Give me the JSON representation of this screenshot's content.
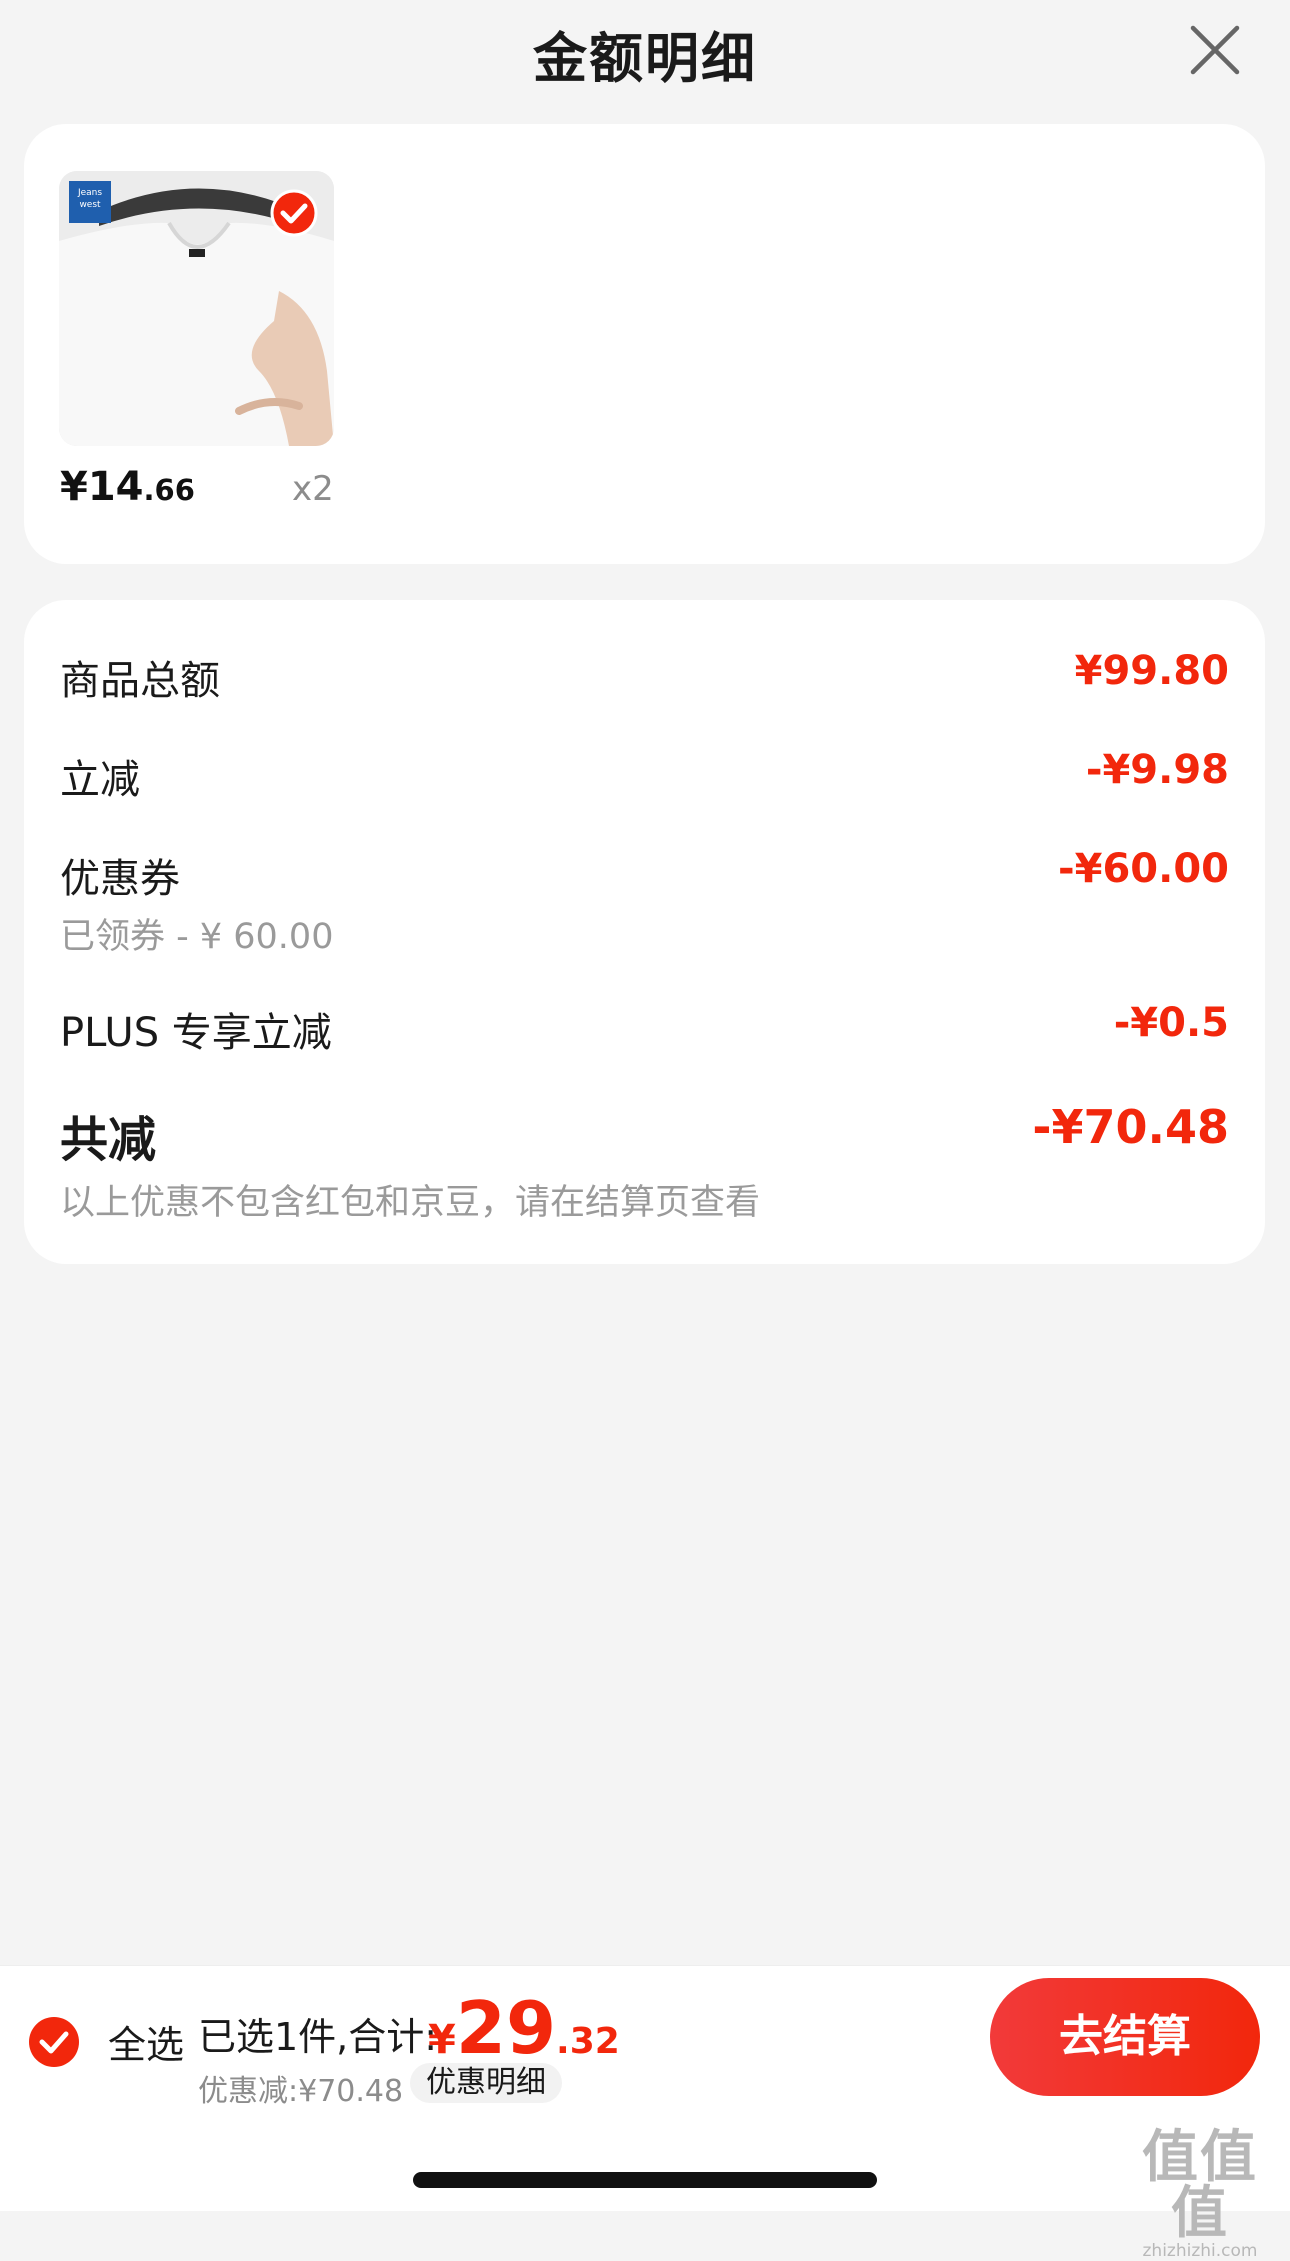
{
  "header": {
    "title": "金额明细"
  },
  "product": {
    "brand_logo_text": "Jeans west",
    "price_int": "¥14",
    "price_dec": ".66",
    "qty": "x2"
  },
  "summary": {
    "goods_total_label": "商品总额",
    "goods_total_value": "¥99.80",
    "instant_discount_label": "立减",
    "instant_discount_value": "-¥9.98",
    "coupon_label": "优惠券",
    "coupon_value": "-¥60.00",
    "coupon_note": "已领券 - ¥ 60.00",
    "plus_label": "PLUS 专享立减",
    "plus_value": "-¥0.5",
    "total_label": "共减",
    "total_value": "-¥70.48",
    "note": "以上优惠不包含红包和京豆，请在结算页查看"
  },
  "bottom": {
    "select_all": "全选",
    "selected_count": "已选1件,合计:",
    "total_currency": "¥",
    "total_int": "29",
    "total_dec": ".32",
    "saved": "优惠减:¥70.48",
    "detail_button": "优惠明细",
    "checkout_button": "去结算"
  },
  "watermark": {
    "main": "值值值",
    "sub": "zhizhizhi.com"
  },
  "colors": {
    "accent": "#f2270c",
    "background": "#f4f4f4",
    "card": "#ffffff"
  }
}
